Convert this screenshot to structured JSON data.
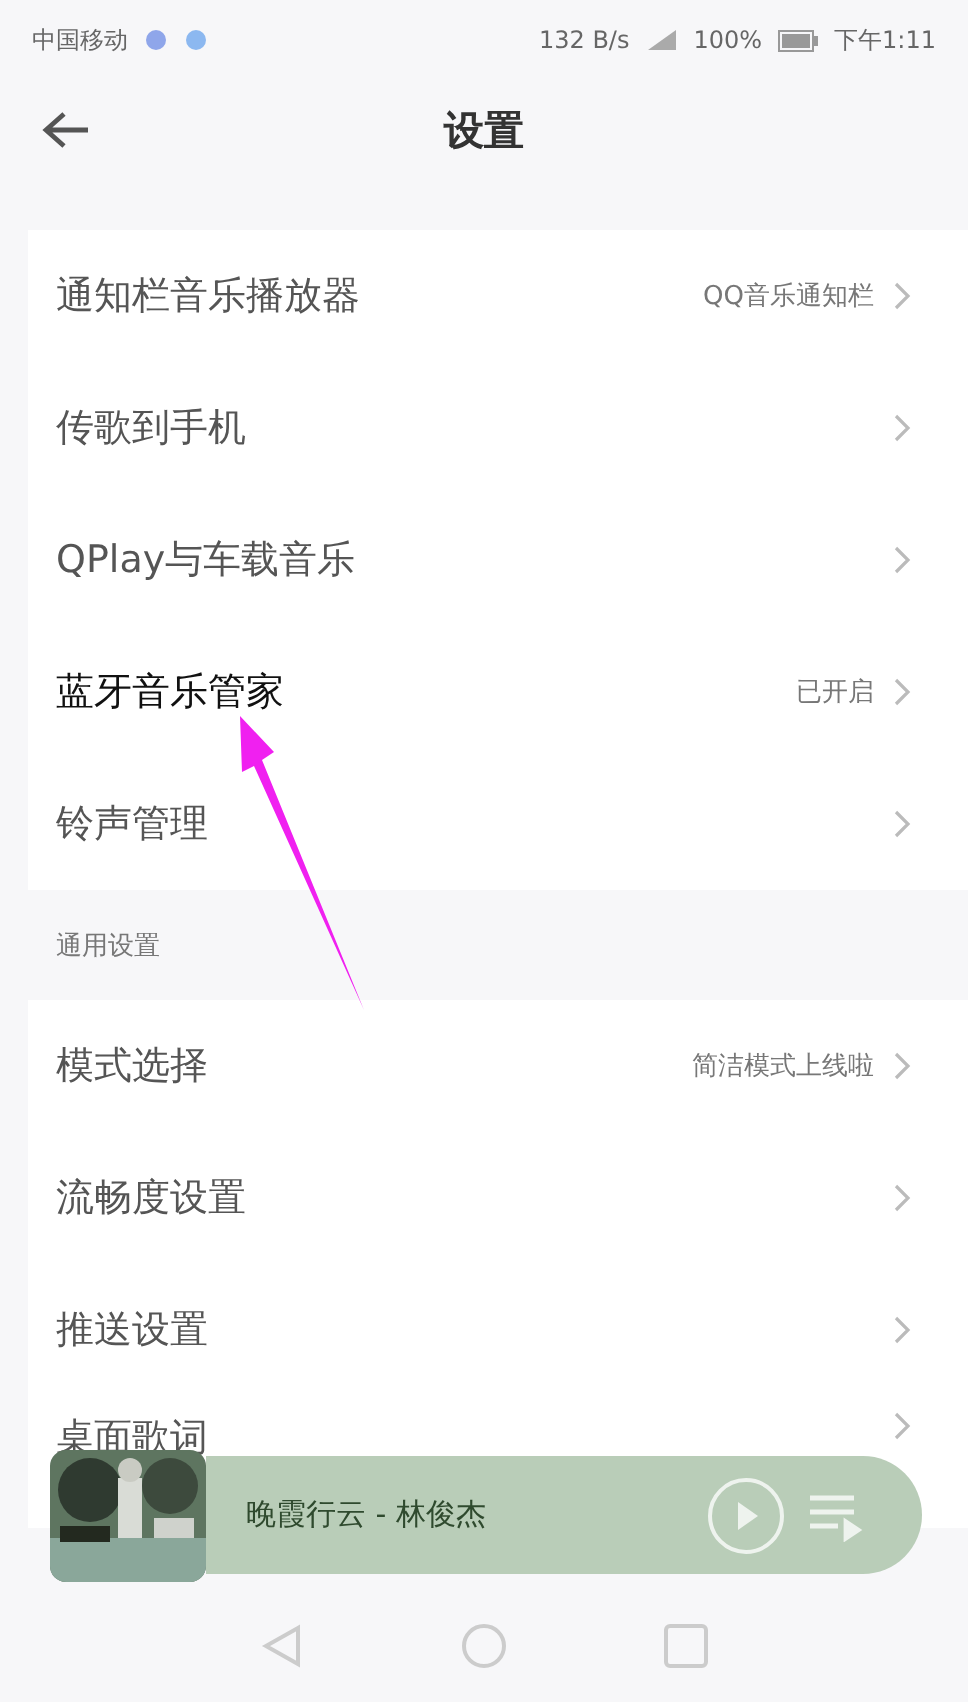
{
  "status_bar": {
    "carrier": "中国移动",
    "speed": "132 B/s",
    "battery": "100%",
    "time": "下午1:11"
  },
  "header": {
    "title": "设置"
  },
  "sections": [
    {
      "items": [
        {
          "label": "通知栏音乐播放器",
          "value": "QQ音乐通知栏"
        },
        {
          "label": "传歌到手机"
        },
        {
          "label": "QPlay与车载音乐"
        },
        {
          "label": "蓝牙音乐管家",
          "value": "已开启",
          "highlighted": true
        },
        {
          "label": "铃声管理"
        }
      ]
    },
    {
      "title": "通用设置",
      "items": [
        {
          "label": "模式选择",
          "value": "简洁模式上线啦"
        },
        {
          "label": "流畅度设置"
        },
        {
          "label": "推送设置"
        },
        {
          "label": "桌面歌词"
        }
      ]
    }
  ],
  "mini_player": {
    "song": "晚霞行云 - 林俊杰"
  },
  "annotation": {
    "kind": "arrow"
  }
}
